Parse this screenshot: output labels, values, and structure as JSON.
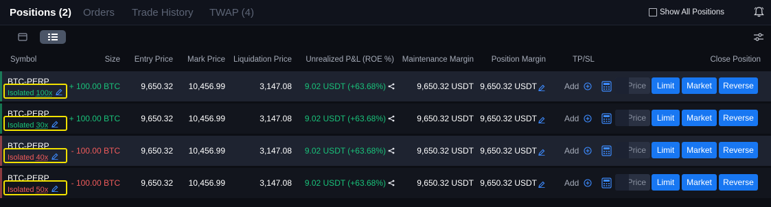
{
  "tabs": [
    {
      "label": "Positions (2)",
      "active": true
    },
    {
      "label": "Orders",
      "active": false
    },
    {
      "label": "Trade History",
      "active": false
    },
    {
      "label": "TWAP (4)",
      "active": false
    }
  ],
  "show_all_label": "Show All Positions",
  "show_all_checked": false,
  "icons": {
    "bell": "bell-icon",
    "filter": "sliders-icon",
    "edit": "pencil-icon",
    "share": "share-icon",
    "add": "plus-circle-icon",
    "calculator": "calculator-icon"
  },
  "colors": {
    "long": "#19c27a",
    "short": "#f05b5b",
    "pnl": "#19c27a",
    "button": "#1877f2",
    "highlight": "#f2e200"
  },
  "headers": {
    "symbol": "Symbol",
    "size": "Size",
    "entry": "Entry Price",
    "mark": "Mark Price",
    "liq": "Liquidation Price",
    "pnl": "Unrealized P&L (ROE %)",
    "mm": "Maintenance Margin",
    "pm": "Position Margin",
    "tpsl": "TP/SL",
    "close": "Close Position"
  },
  "rows": [
    {
      "symbol": "BTC-PERP",
      "margin_mode": "Isolated",
      "leverage": "100x",
      "side": "long",
      "size": "+ 100.00 BTC",
      "entry": "9,650.32",
      "mark": "10,456.99",
      "liq": "3,147.08",
      "pnl": "9.02 USDT (+63.68%)",
      "mm": "9,650.32 USDT",
      "pm": "9,650.32 USDT",
      "add": "Add",
      "price_placeholder": "Price",
      "limit": "Limit",
      "market": "Market",
      "reverse": "Reverse"
    },
    {
      "symbol": "BTC-PERP",
      "margin_mode": "Isolated",
      "leverage": "30x",
      "side": "long",
      "size": "+ 100.00 BTC",
      "entry": "9,650.32",
      "mark": "10,456.99",
      "liq": "3,147.08",
      "pnl": "9.02 USDT (+63.68%)",
      "mm": "9,650.32 USDT",
      "pm": "9,650.32 USDT",
      "add": "Add",
      "price_placeholder": "Price",
      "limit": "Limit",
      "market": "Market",
      "reverse": "Reverse"
    },
    {
      "symbol": "BTC-PERP",
      "margin_mode": "Isolated",
      "leverage": "40x",
      "side": "short",
      "size": "- 100.00 BTC",
      "entry": "9,650.32",
      "mark": "10,456.99",
      "liq": "3,147.08",
      "pnl": "9.02 USDT (+63.68%)",
      "mm": "9,650.32 USDT",
      "pm": "9,650.32 USDT",
      "add": "Add",
      "price_placeholder": "Price",
      "limit": "Limit",
      "market": "Market",
      "reverse": "Reverse"
    },
    {
      "symbol": "BTC-PERP",
      "margin_mode": "Isolated",
      "leverage": "50x",
      "side": "short",
      "size": "- 100.00 BTC",
      "entry": "9,650.32",
      "mark": "10,456.99",
      "liq": "3,147.08",
      "pnl": "9.02 USDT (+63.68%)",
      "mm": "9,650.32 USDT",
      "pm": "9,650.32 USDT",
      "add": "Add",
      "price_placeholder": "Price",
      "limit": "Limit",
      "market": "Market",
      "reverse": "Reverse"
    }
  ]
}
